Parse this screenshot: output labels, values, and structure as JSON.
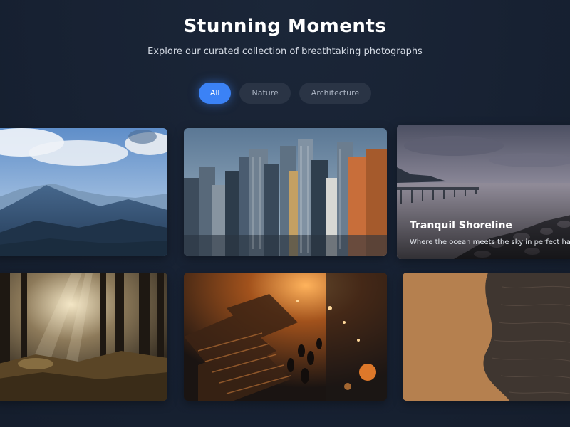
{
  "header": {
    "title": "Stunning Moments",
    "subtitle": "Explore our curated collection of breathtaking photographs"
  },
  "filters": [
    {
      "label": "All",
      "active": true
    },
    {
      "label": "Nature",
      "active": false
    },
    {
      "label": "Architecture",
      "active": false
    }
  ],
  "gallery": {
    "featured": {
      "title": "Tranquil Shoreline",
      "description": "Where the ocean meets the sky in perfect harmony"
    }
  },
  "colors": {
    "background": "#182233",
    "accent": "#3b82f6",
    "chip": "#2a3445"
  }
}
